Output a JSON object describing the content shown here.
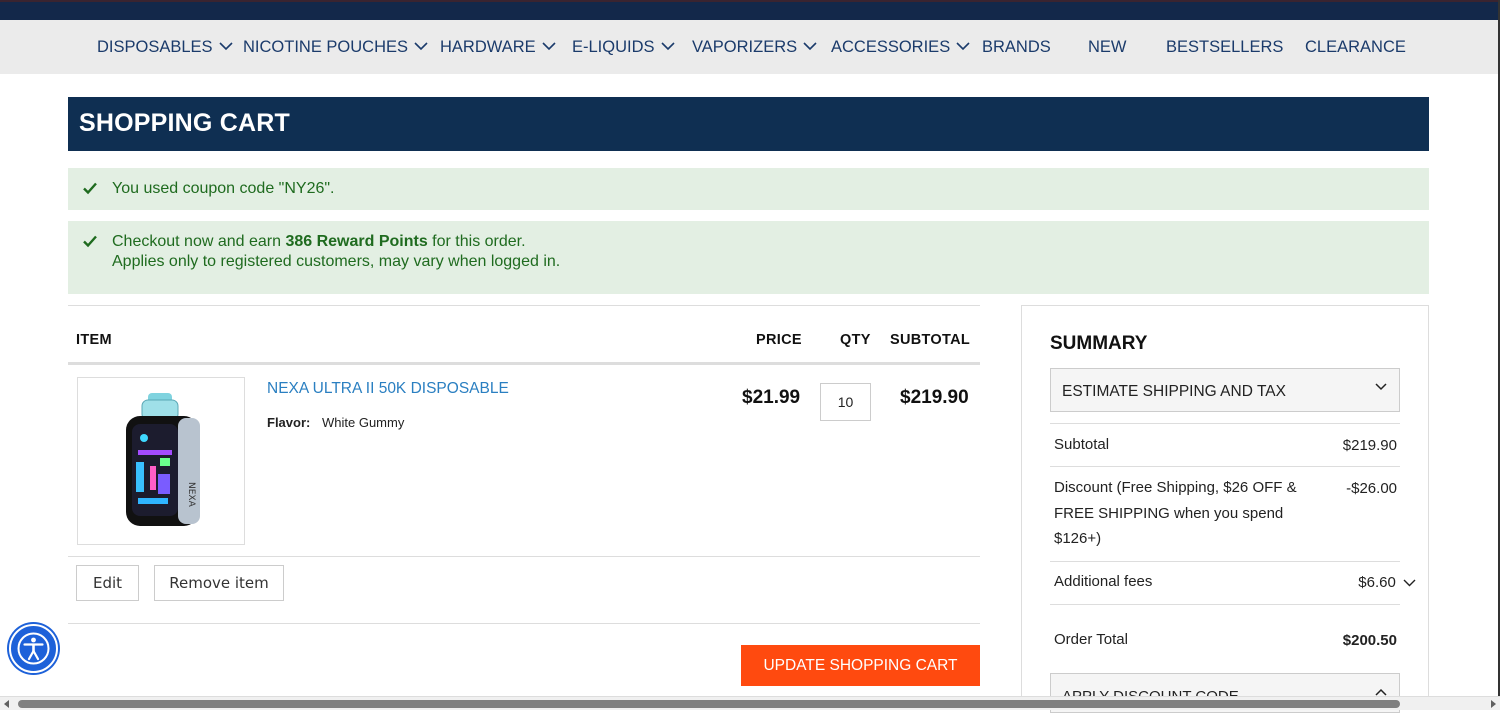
{
  "nav": {
    "items": [
      {
        "label": "DISPOSABLES",
        "has_dropdown": true
      },
      {
        "label": "NICOTINE POUCHES",
        "has_dropdown": true
      },
      {
        "label": "HARDWARE",
        "has_dropdown": true
      },
      {
        "label": "E-LIQUIDS",
        "has_dropdown": true
      },
      {
        "label": "VAPORIZERS",
        "has_dropdown": true
      },
      {
        "label": "ACCESSORIES",
        "has_dropdown": true
      },
      {
        "label": "BRANDS",
        "has_dropdown": false
      },
      {
        "label": "NEW",
        "has_dropdown": false
      },
      {
        "label": "BESTSELLERS",
        "has_dropdown": false
      },
      {
        "label": "CLEARANCE",
        "has_dropdown": false
      }
    ]
  },
  "page": {
    "title": "SHOPPING CART"
  },
  "messages": {
    "coupon": "You used coupon code \"NY26\".",
    "reward_prefix": "Checkout now and earn ",
    "reward_points": "386 Reward Points",
    "reward_suffix": " for this order.",
    "reward_note": "Applies only to registered customers, may vary when logged in."
  },
  "cart": {
    "headers": {
      "item": "ITEM",
      "price": "PRICE",
      "qty": "QTY",
      "subtotal": "SUBTOTAL"
    },
    "items": [
      {
        "name": "NEXA ULTRA II 50K DISPOSABLE",
        "flavor_label": "Flavor:",
        "flavor": "White Gummy",
        "price": "$21.99",
        "qty": "10",
        "subtotal": "$219.90"
      }
    ],
    "edit_label": "Edit",
    "remove_label": "Remove item",
    "update_label": "UPDATE SHOPPING CART"
  },
  "summary": {
    "title": "SUMMARY",
    "estimate_label": "ESTIMATE SHIPPING AND TAX",
    "subtotal_label": "Subtotal",
    "subtotal_value": "$219.90",
    "discount_label": "Discount (Free Shipping, $26 OFF & FREE SHIPPING when you spend $126+)",
    "discount_value": "-$26.00",
    "fees_label": "Additional fees",
    "fees_value": "$6.60",
    "total_label": "Order Total",
    "total_value": "$200.50",
    "apply_discount_label": "APPLY DISCOUNT CODE"
  },
  "colors": {
    "nav_bg": "#ebebeb",
    "nav_text": "#1b3b6b",
    "header_bg": "#0f2f52",
    "success_bg": "#e3efe3",
    "success_text": "#1f6b1f",
    "link": "#2a7fc1",
    "accent_button": "#ff4a0f",
    "accessibility": "#1d61d9"
  },
  "icons": {
    "check": "check-icon",
    "chevron": "chevron-down-icon",
    "accessibility": "accessibility-icon"
  }
}
